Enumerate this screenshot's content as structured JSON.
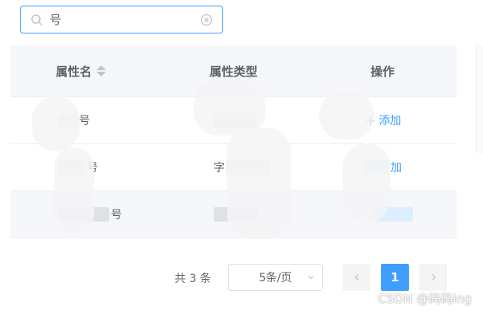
{
  "search": {
    "value": "号",
    "placeholder": ""
  },
  "table": {
    "headers": {
      "name": "属性名",
      "type": "属性类型",
      "op": "操作"
    },
    "rows": [
      {
        "name": "号",
        "type": "",
        "op": "添加"
      },
      {
        "name": "号",
        "type": "字",
        "op": "加"
      },
      {
        "name": "号",
        "type": "",
        "op": ""
      }
    ]
  },
  "pagination": {
    "total": "共 3 条",
    "page_size": "5条/页",
    "current_page": "1"
  },
  "watermark": "CSDN @码码ing",
  "colors": {
    "primary": "#409eff",
    "header_bg": "#f5f7fa",
    "border": "#ebeef5"
  },
  "icons": {
    "search": "search-icon",
    "clear": "circle-close-icon",
    "sort": "sort-caret-icon",
    "prev": "chevron-left-icon",
    "next": "chevron-right-icon",
    "dropdown": "chevron-down-icon"
  }
}
